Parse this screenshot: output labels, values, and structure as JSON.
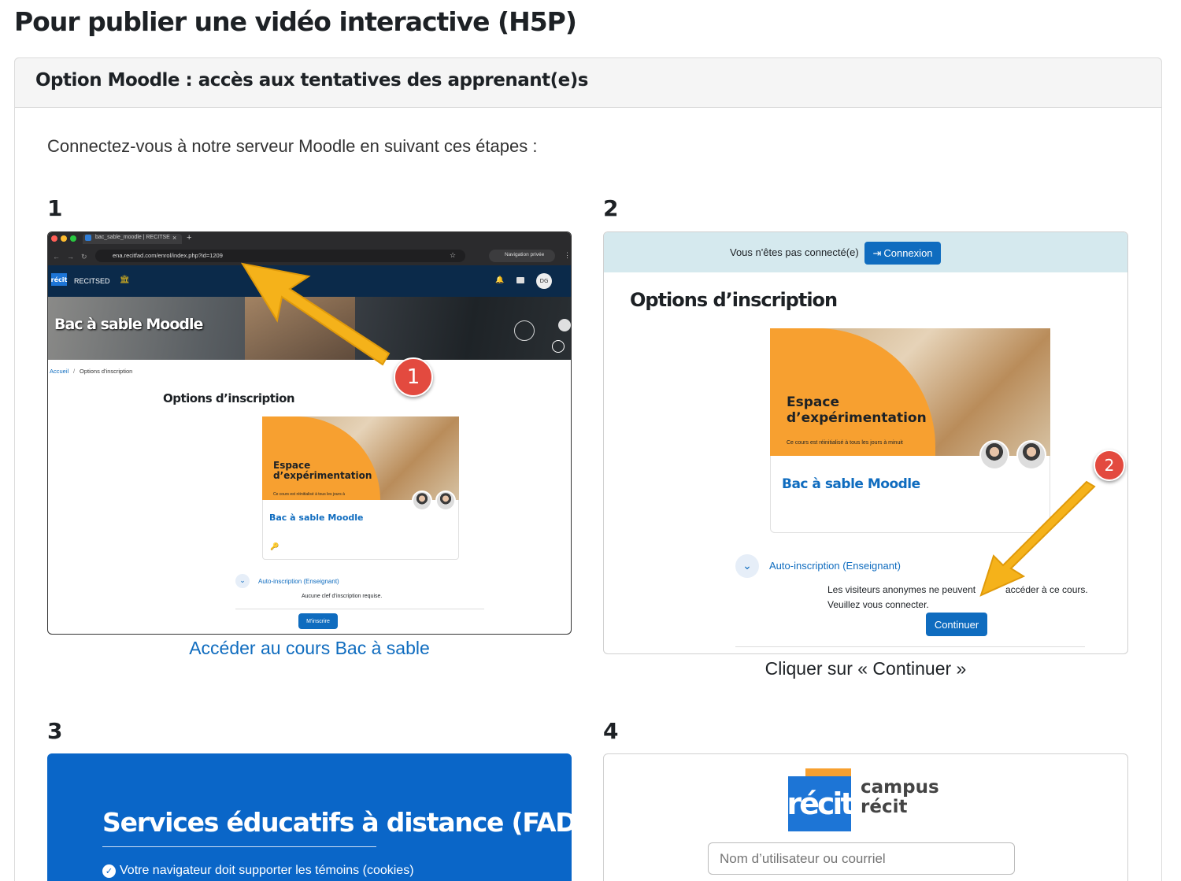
{
  "page_title": "Pour publier une vidéo interactive (H5P)",
  "card_title": "Option Moodle : accès aux tentatives des apprenant(e)s",
  "intro": "Connectez-vous à notre serveur Moodle en suivant ces étapes :",
  "steps": [
    {
      "number": "1",
      "caption": "Accéder au cours Bac à sable",
      "browser": {
        "tab_title": "bac_sable_moodle | RECITSE",
        "new_tab": "+",
        "url": "ena.recitfad.com/enrol/index.php?id=1209",
        "private_label": "Navigation privée",
        "logo_text": "récit",
        "site_name": "RECITSED",
        "user_initials": "DG",
        "banner_title": "Bac à sable Moodle",
        "breadcrumb_home": "Accueil",
        "breadcrumb_sep": "/",
        "breadcrumb_current": "Options d'inscription",
        "heading": "Options d’inscription",
        "course_card_title": "Espace d’expérimentation",
        "course_card_sub": "Ce cours est réinitialisé à tous les jours à",
        "course_name": "Bac à sable Moodle",
        "enrol_method": "Auto-inscription (Enseignant)",
        "enrol_note": "Aucune clef d’inscription requise.",
        "enrol_button": "M'inscrire"
      },
      "badge": "1"
    },
    {
      "number": "2",
      "caption": "Cliquer sur « Continuer »",
      "notice": "Vous n'êtes pas connecté(e)",
      "login_button": "Connexion",
      "heading": "Options d’inscription",
      "course_card_title": "Espace d’expérimentation",
      "course_card_sub": "Ce cours est réinitialisé à tous les jours à minuit",
      "course_name": "Bac à sable Moodle",
      "enrol_method": "Auto-inscription (Enseignant)",
      "guest_msg_1": "Les visiteurs anonymes ne peuvent",
      "guest_msg_1b": "accéder à ce cours.",
      "guest_msg_2": "Veuillez vous connecter.",
      "continue_button": "Continuer",
      "badge": "2"
    },
    {
      "number": "3",
      "title": "Services éducatifs à distance (FAD)",
      "requirement": "Votre navigateur doit supporter les témoins (cookies)"
    },
    {
      "number": "4",
      "logo_text": "récit",
      "campus_line1": "campus",
      "campus_line2": "récit",
      "username_placeholder": "Nom d’utilisateur ou courriel"
    }
  ],
  "colors": {
    "moodle_blue": "#0f6cbf",
    "moodle_navy": "#0b2a4a",
    "arrow_yellow": "#f5b21a",
    "badge_red": "#e34a3f",
    "orange": "#f7a030",
    "fad_blue": "#0a66c8"
  }
}
